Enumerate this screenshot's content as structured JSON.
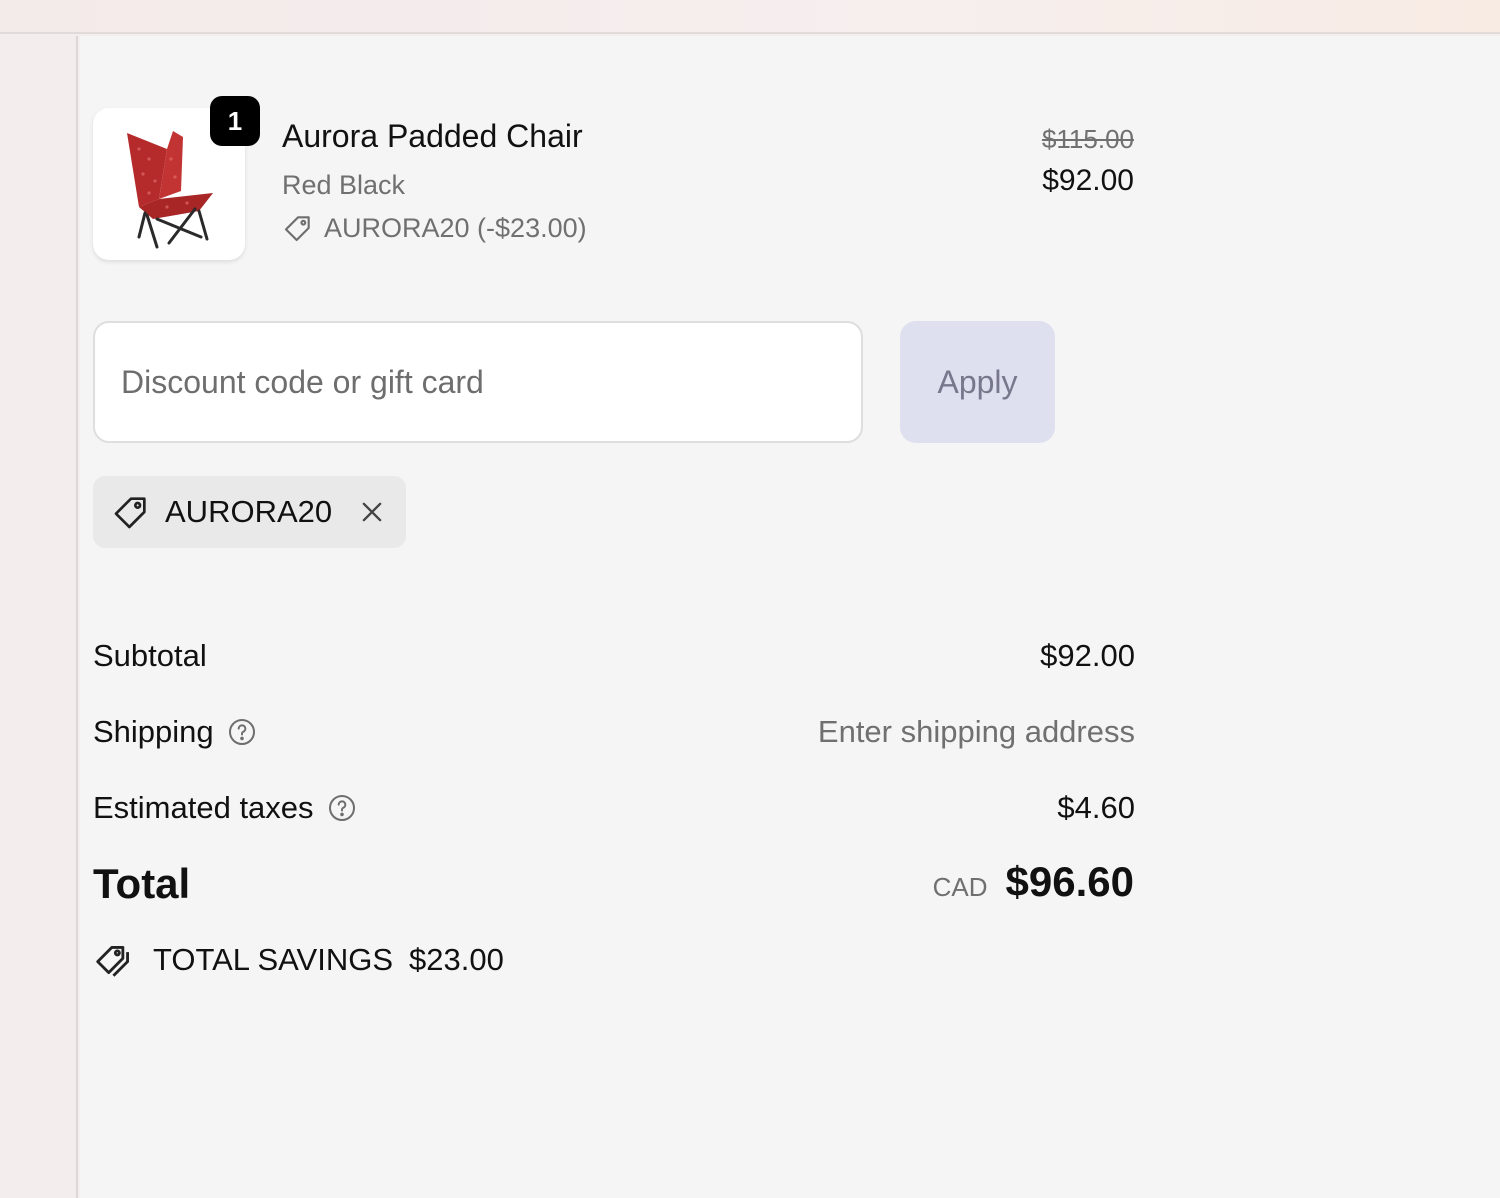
{
  "line_item": {
    "quantity": "1",
    "name": "Aurora Padded Chair",
    "variant": "Red Black",
    "discount": "AURORA20 (-$23.00)",
    "original_price": "$115.00",
    "price": "$92.00",
    "image_icon": "red-folding-chair"
  },
  "discount_form": {
    "placeholder": "Discount code or gift card",
    "value": "",
    "apply_label": "Apply"
  },
  "applied_code": {
    "code": "AURORA20",
    "icon": "tag-icon",
    "remove_icon": "close-icon"
  },
  "summary": {
    "subtotal_label": "Subtotal",
    "subtotal_value": "$92.00",
    "shipping_label": "Shipping",
    "shipping_value": "Enter shipping address",
    "taxes_label": "Estimated taxes",
    "taxes_value": "$4.60",
    "total_label": "Total",
    "currency": "CAD",
    "total_value": "$96.60",
    "savings_label": "TOTAL SAVINGS",
    "savings_value": "$23.00"
  },
  "colors": {
    "apply_button_bg": "#dedfef",
    "page_bg": "#f5f5f5",
    "badge_bg": "#000000"
  }
}
